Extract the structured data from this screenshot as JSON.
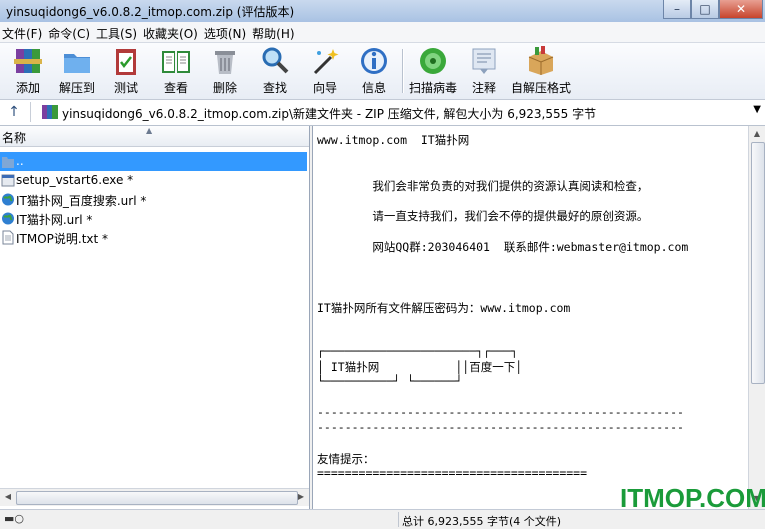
{
  "window": {
    "title": "yinsuqidong6_v6.0.8.2_itmop.com.zip (评估版本)",
    "controls": [
      "minimize",
      "maximize",
      "close"
    ]
  },
  "menu": [
    "文件(F)",
    "命令(C)",
    "工具(S)",
    "收藏夹(O)",
    "选项(N)",
    "帮助(H)"
  ],
  "toolbar": [
    {
      "label": "添加",
      "icon": "add-archive-icon"
    },
    {
      "label": "解压到",
      "icon": "extract-folder-icon"
    },
    {
      "label": "测试",
      "icon": "test-clipboard-icon"
    },
    {
      "label": "查看",
      "icon": "view-book-icon"
    },
    {
      "label": "删除",
      "icon": "trash-icon"
    },
    {
      "label": "查找",
      "icon": "magnifier-icon"
    },
    {
      "label": "向导",
      "icon": "wizard-wand-icon"
    },
    {
      "label": "信息",
      "icon": "info-icon"
    },
    {
      "label": "扫描病毒",
      "icon": "virus-scan-icon"
    },
    {
      "label": "注释",
      "icon": "comment-note-icon"
    },
    {
      "label": "自解压格式",
      "icon": "sfx-box-icon"
    }
  ],
  "address": {
    "path": "yinsuqidong6_v6.0.8.2_itmop.com.zip\\新建文件夹 - ZIP 压缩文件, 解包大小为 6,923,555 字节"
  },
  "file_list": {
    "column_name": "名称",
    "items": [
      {
        "name": "..",
        "icon": "folder-up-icon",
        "selected": true
      },
      {
        "name": "setup_vstart6.exe *",
        "icon": "exe-icon",
        "selected": false
      },
      {
        "name": "IT猫扑网_百度搜索.url *",
        "icon": "url-globe-icon",
        "selected": false
      },
      {
        "name": "IT猫扑网.url *",
        "icon": "url-globe-icon",
        "selected": false
      },
      {
        "name": "ITMOP说明.txt *",
        "icon": "txt-file-icon",
        "selected": false
      }
    ]
  },
  "comment_lines": [
    "www.itmop.com  IT猫扑网",
    "        我们会非常负责的对我们提供的资源认真阅读和检查，",
    "        请一直支持我们，我们会不停的提供最好的原创资源。",
    "        网站QQ群:203046401  联系邮件:webmaster@itmop.com",
    "IT猫扑网所有文件解压密码为：www.itmop.com",
    "┌──────────────────────┐┌───┐",
    "│ IT猫扑网           ││百度一下│",
    "└──────────┘ └──────┘",
    "-----------------------------------------------------",
    "-----------------------------------------------------",
    "友情提示：",
    "======================================="
  ],
  "status": {
    "total": "总计 6,923,555 字节(4 个文件)"
  },
  "watermark": "ITMOP.COM"
}
